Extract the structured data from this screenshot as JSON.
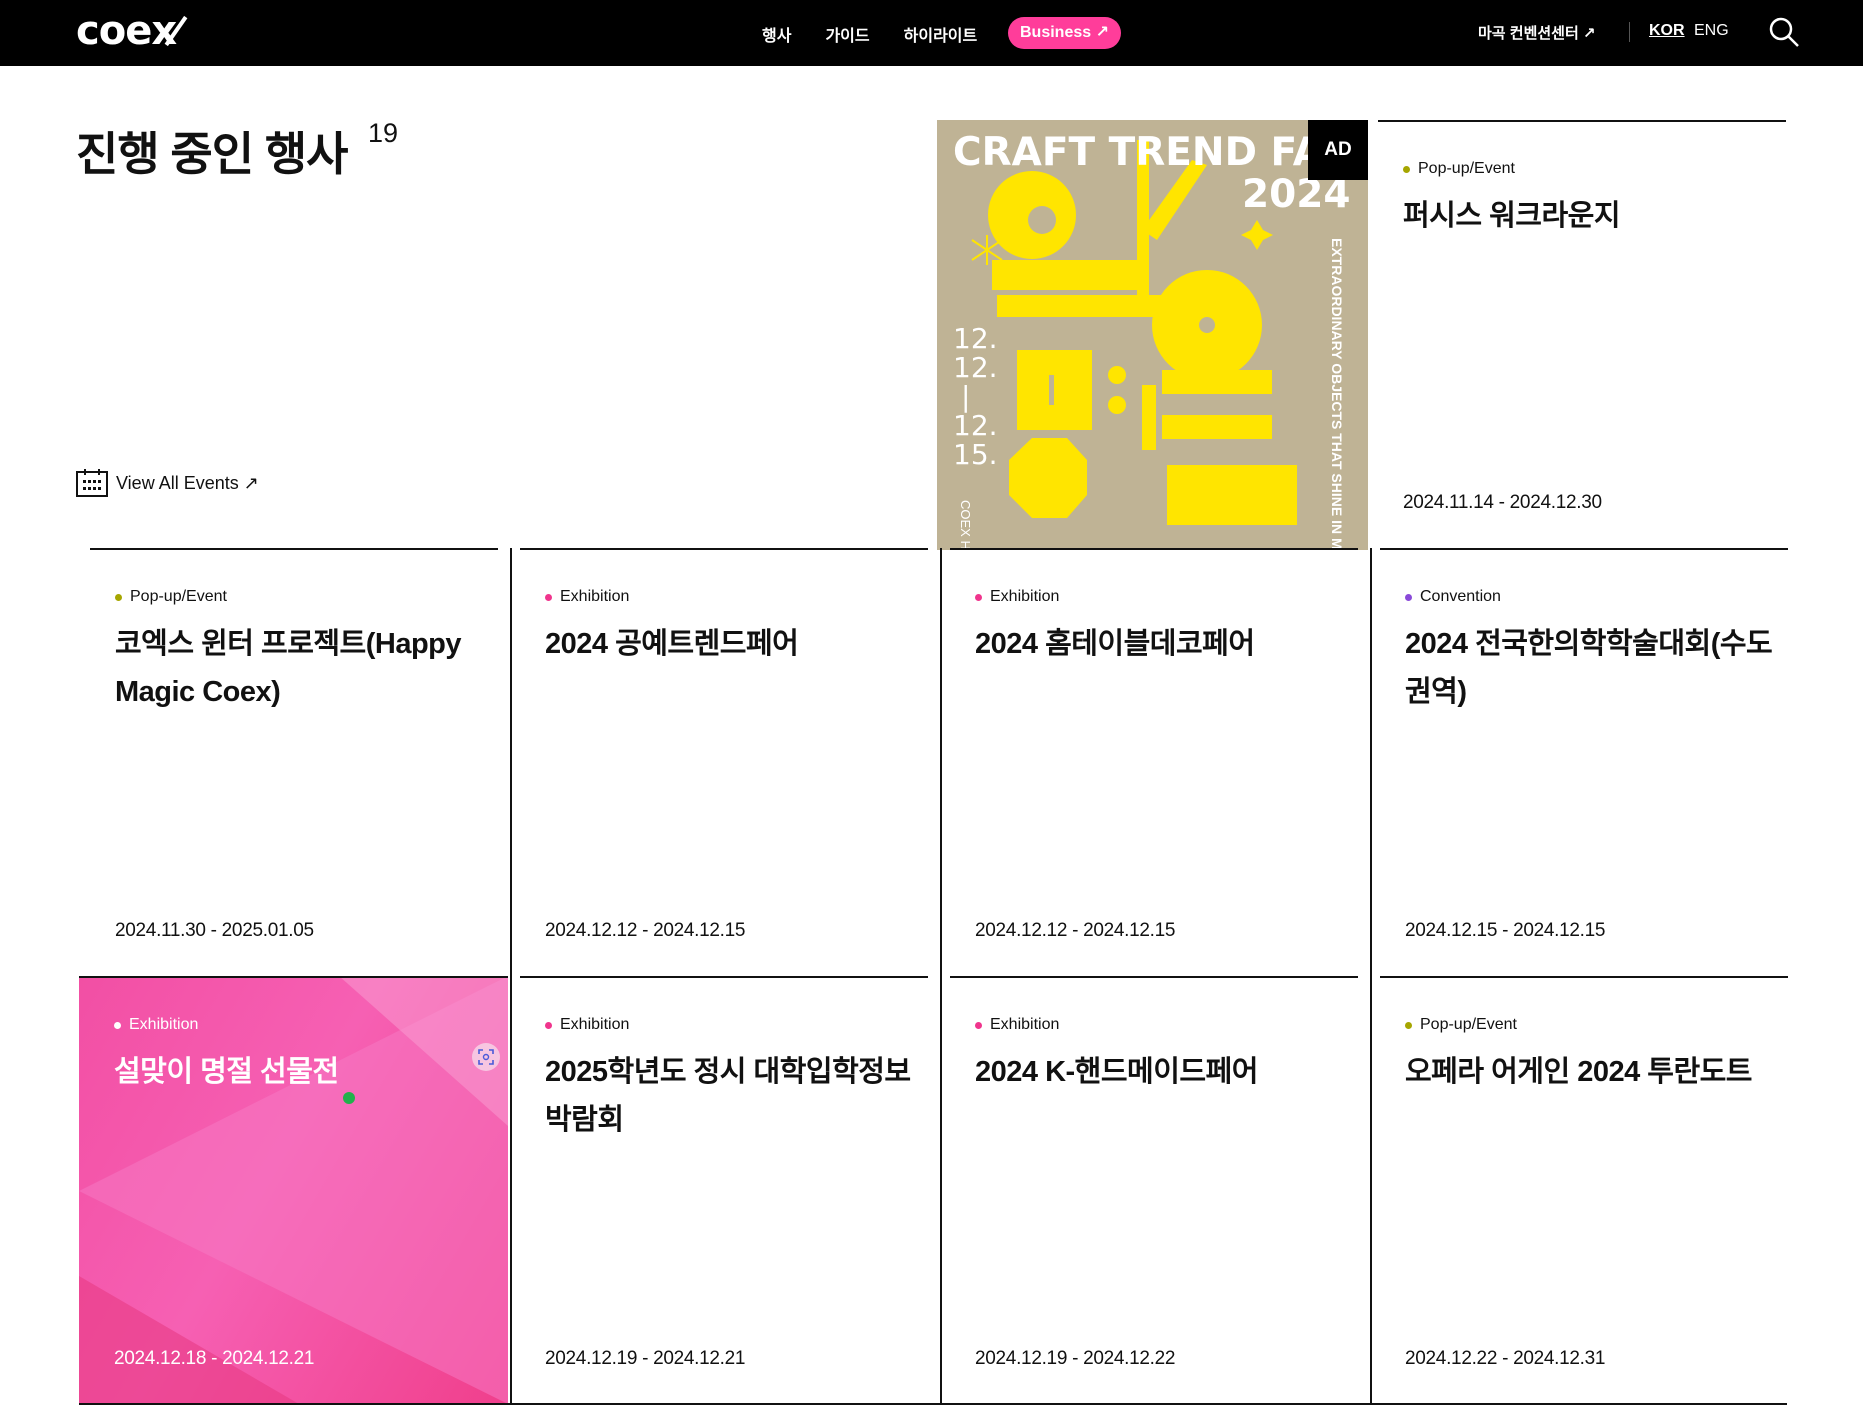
{
  "header": {
    "logo": "coex",
    "nav": [
      "행사",
      "가이드",
      "하이라이트"
    ],
    "business": "Business ↗",
    "venue": "마곡 컨벤션센터 ↗",
    "lang_kor": "KOR",
    "lang_eng": "ENG"
  },
  "main": {
    "title": "진행 중인 행사",
    "count": "19",
    "view_all": "View All Events ↗"
  },
  "ad": {
    "label": "AD",
    "headline": "CRAFT TREND FA",
    "year": "2024",
    "dates": [
      "12.",
      "12.",
      "|",
      "12.",
      "15."
    ],
    "hall": "COEX HALL C",
    "side_text": "EXTRAORDINARY OBJECTS THAT SHINE IN MY LIFE"
  },
  "events": [
    {
      "category": "Pop-up/Event",
      "dot": "#a6a600",
      "title": "퍼시스 워크라운지",
      "dates": "2024.11.14 - 2024.12.30"
    },
    {
      "category": "Pop-up/Event",
      "dot": "#a6a600",
      "title": "코엑스 윈터 프로젝트(Happy Magic Coex)",
      "dates": "2024.11.30 - 2025.01.05"
    },
    {
      "category": "Exhibition",
      "dot": "#f0358d",
      "title": "2024 공예트렌드페어",
      "dates": "2024.12.12 - 2024.12.15"
    },
    {
      "category": "Exhibition",
      "dot": "#f0358d",
      "title": "2024 홈테이블데코페어",
      "dates": "2024.12.12 - 2024.12.15"
    },
    {
      "category": "Convention",
      "dot": "#8a4ad9",
      "title": "2024 전국한의학학술대회(수도권역)",
      "dates": "2024.12.15 - 2024.12.15"
    },
    {
      "category": "Exhibition",
      "dot": "#ffffff",
      "title": "설맞이 명절 선물전",
      "dates": "2024.12.18 - 2024.12.21"
    },
    {
      "category": "Exhibition",
      "dot": "#f0358d",
      "title": "2025학년도 정시 대학입학정보박람회",
      "dates": "2024.12.19 - 2024.12.21"
    },
    {
      "category": "Exhibition",
      "dot": "#f0358d",
      "title": "2024 K-핸드메이드페어",
      "dates": "2024.12.19 - 2024.12.22"
    },
    {
      "category": "Pop-up/Event",
      "dot": "#a6a600",
      "title": "오페라 어게인 2024 투란도트",
      "dates": "2024.12.22 - 2024.12.31"
    }
  ],
  "colors": {
    "accent": "#ff3d9a",
    "ad_bg": "#bfb395",
    "ad_yellow": "#ffe500"
  }
}
